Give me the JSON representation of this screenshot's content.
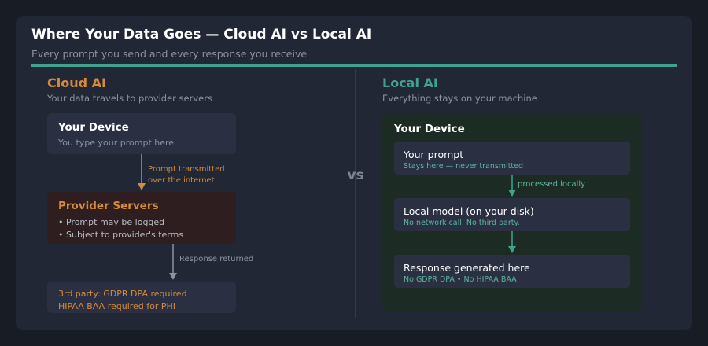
{
  "header": {
    "title": "Where Your Data Goes — Cloud AI vs Local AI",
    "subtitle": "Every prompt you send and every response you receive"
  },
  "vs_label": "vs",
  "colors": {
    "accent_teal": "#3fa390",
    "cloud_orange": "#d68a3c",
    "local_green": "#1c2c24",
    "arrow_gray": "#8b93a3"
  },
  "cloud": {
    "title": "Cloud AI",
    "subtitle": "Your data travels to provider servers",
    "device": {
      "title": "Your Device",
      "text": "You type your prompt here"
    },
    "transmit_label": [
      "Prompt transmitted",
      "over the internet"
    ],
    "provider": {
      "title": "Provider Servers",
      "bullets": [
        "• Prompt may be logged",
        "• Subject to provider's terms"
      ]
    },
    "return_label": "Response returned",
    "third_party": [
      "3rd party: GDPR DPA required",
      "HIPAA BAA required for PHI"
    ]
  },
  "local": {
    "title": "Local AI",
    "subtitle": "Everything stays on your machine",
    "device_title": "Your Device",
    "steps": [
      {
        "title": "Your prompt",
        "note": "Stays here — never transmitted"
      },
      {
        "title": "Local model (on your disk)",
        "note": "No network call. No third party."
      },
      {
        "title": "Response generated here",
        "note": "No GDPR DPA  •  No HIPAA BAA"
      }
    ],
    "process_label": "processed locally"
  }
}
